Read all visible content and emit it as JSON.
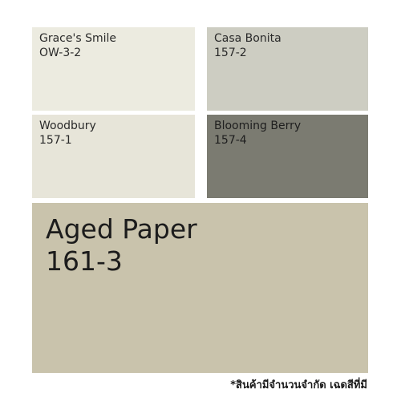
{
  "swatches": [
    {
      "name": "Grace's Smile",
      "code": "OW-3-2",
      "color": "#ecebe0",
      "text_color": "#2a2a2a"
    },
    {
      "name": "Casa Bonita",
      "code": "157-2",
      "color": "#cdcdc2",
      "text_color": "#2a2a2a"
    },
    {
      "name": "Woodbury",
      "code": "157-1",
      "color": "#e7e5d9",
      "text_color": "#2a2a2a"
    },
    {
      "name": "Blooming Berry",
      "code": "157-4",
      "color": "#7b7b71",
      "text_color": "#1e1e1e"
    }
  ],
  "featured": {
    "name": "Aged Paper",
    "code": "161-3",
    "color": "#c9c3ac",
    "text_color": "#1c1c1c"
  },
  "note": "*สินค้ามีจำนวนจำกัด เฉดสีที่มี"
}
